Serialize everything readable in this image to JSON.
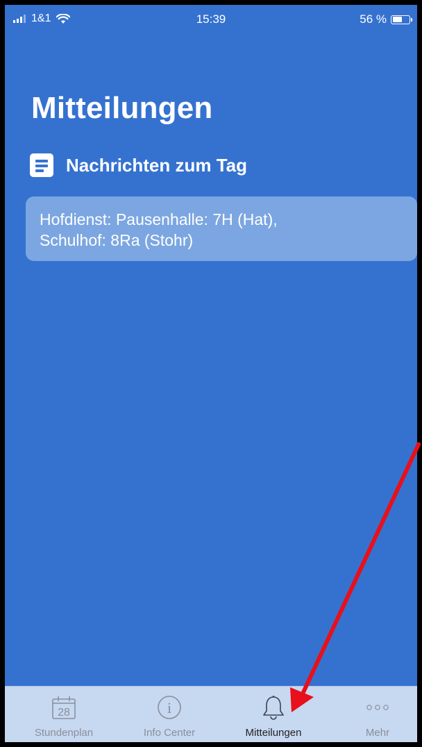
{
  "status_bar": {
    "carrier": "1&1",
    "time": "15:39",
    "battery": "56 %",
    "battery_level": 0.56
  },
  "page": {
    "title": "Mitteilungen"
  },
  "section": {
    "icon": "document-icon",
    "title": "Nachrichten zum Tag"
  },
  "messages": [
    {
      "line1": "Hofdienst: Pausenhalle: 7H (Hat),",
      "line2": "Schulhof: 8Ra (Stohr)"
    }
  ],
  "tab_bar": {
    "tabs": [
      {
        "label": "Stundenplan",
        "icon": "calendar-icon",
        "badge": "28",
        "active": false
      },
      {
        "label": "Info Center",
        "icon": "info-icon",
        "badge": "i",
        "active": false
      },
      {
        "label": "Mitteilungen",
        "icon": "bell-icon",
        "active": true
      },
      {
        "label": "Mehr",
        "icon": "more-icon",
        "active": false
      }
    ]
  },
  "colors": {
    "background": "#3572d0",
    "card": "#7ba6e1",
    "tab_bar": "#c7d8f1",
    "annotation_arrow": "#e8101a"
  }
}
